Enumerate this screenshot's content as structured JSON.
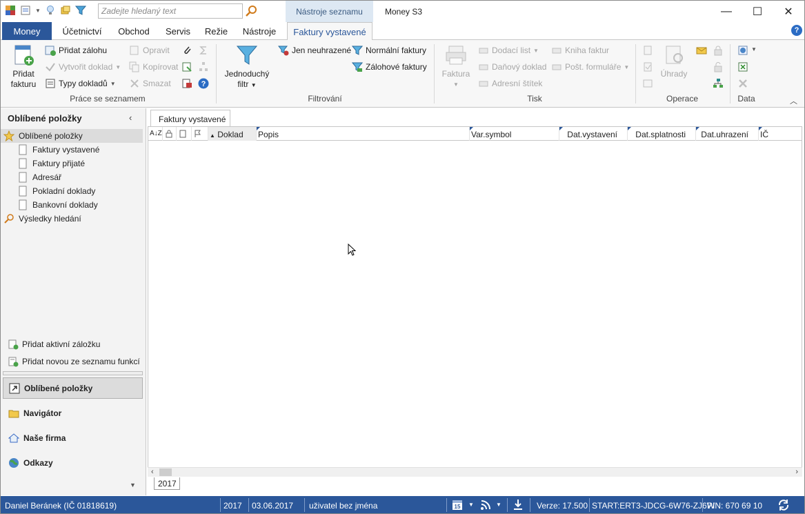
{
  "app_title": "Money S3",
  "search": {
    "placeholder": "Zadejte hledaný text"
  },
  "context_tab": "Nástroje seznamu",
  "window": {
    "minimize": "—",
    "maximize": "☐",
    "close": "✕"
  },
  "tabs": [
    {
      "label": "Money"
    },
    {
      "label": "Účetnictví"
    },
    {
      "label": "Obchod"
    },
    {
      "label": "Servis"
    },
    {
      "label": "Režie"
    },
    {
      "label": "Nástroje"
    },
    {
      "label": "Faktury vystavené"
    }
  ],
  "ribbon": {
    "groups": {
      "list": "Práce se seznamem",
      "filter": "Filtrování",
      "print": "Tisk",
      "ops": "Operace",
      "data": "Data"
    },
    "add_invoice_1": "Přidat",
    "add_invoice_2": "fakturu",
    "add_advance": "Přidat zálohu",
    "create_doc": "Vytvořit doklad",
    "doc_types": "Typy dokladů",
    "edit": "Opravit",
    "copy": "Kopírovat",
    "delete": "Smazat",
    "simple_filter_1": "Jednoduchý",
    "simple_filter_2": "filtr",
    "unpaid_only": "Jen neuhrazené",
    "normal_invoices": "Normální faktury",
    "advance_invoices": "Zálohové faktury",
    "invoice_print": "Faktura",
    "delivery_note": "Dodací list",
    "tax_doc": "Daňový doklad",
    "address_label": "Adresní štítek",
    "invoice_book": "Kniha faktur",
    "postal_forms": "Pošt. formuláře",
    "payments": "Úhrady"
  },
  "left_panel": {
    "header": "Oblíbené položky",
    "tree": [
      {
        "label": "Oblíbené položky"
      },
      {
        "label": "Faktury vystavené"
      },
      {
        "label": "Faktury přijaté"
      },
      {
        "label": "Adresář"
      },
      {
        "label": "Pokladní doklady"
      },
      {
        "label": "Bankovní doklady"
      },
      {
        "label": "Výsledky hledání"
      }
    ],
    "actions": [
      {
        "label": "Přidat aktivní záložku"
      },
      {
        "label": "Přidat novou ze seznamu funkcí"
      }
    ],
    "nav": [
      {
        "label": "Oblíbené položky"
      },
      {
        "label": "Navigátor"
      },
      {
        "label": "Naše firma"
      },
      {
        "label": "Odkazy"
      }
    ]
  },
  "doc_tab": "Faktury vystavené",
  "grid": {
    "sort_icon_text": "A↓Z",
    "columns": [
      "Doklad",
      "Popis",
      "Var.symbol",
      "Dat.vystavení",
      "Dat.splatnosti",
      "Dat.uhrazení",
      "IČ"
    ]
  },
  "year_tab": "2017",
  "status": {
    "user": "Daniel Beránek (IČ 01818619)",
    "year": "2017",
    "date": "03.06.2017",
    "login": "uživatel bez jména",
    "calendar_day": "15",
    "version": "Verze: 17.500",
    "start": "START:ERT3-JDCG-6W76-ZJ6W",
    "pin": "PIN: 670 69 10"
  },
  "colors": {
    "accent": "#2b579a",
    "context": "#dde8f3"
  }
}
